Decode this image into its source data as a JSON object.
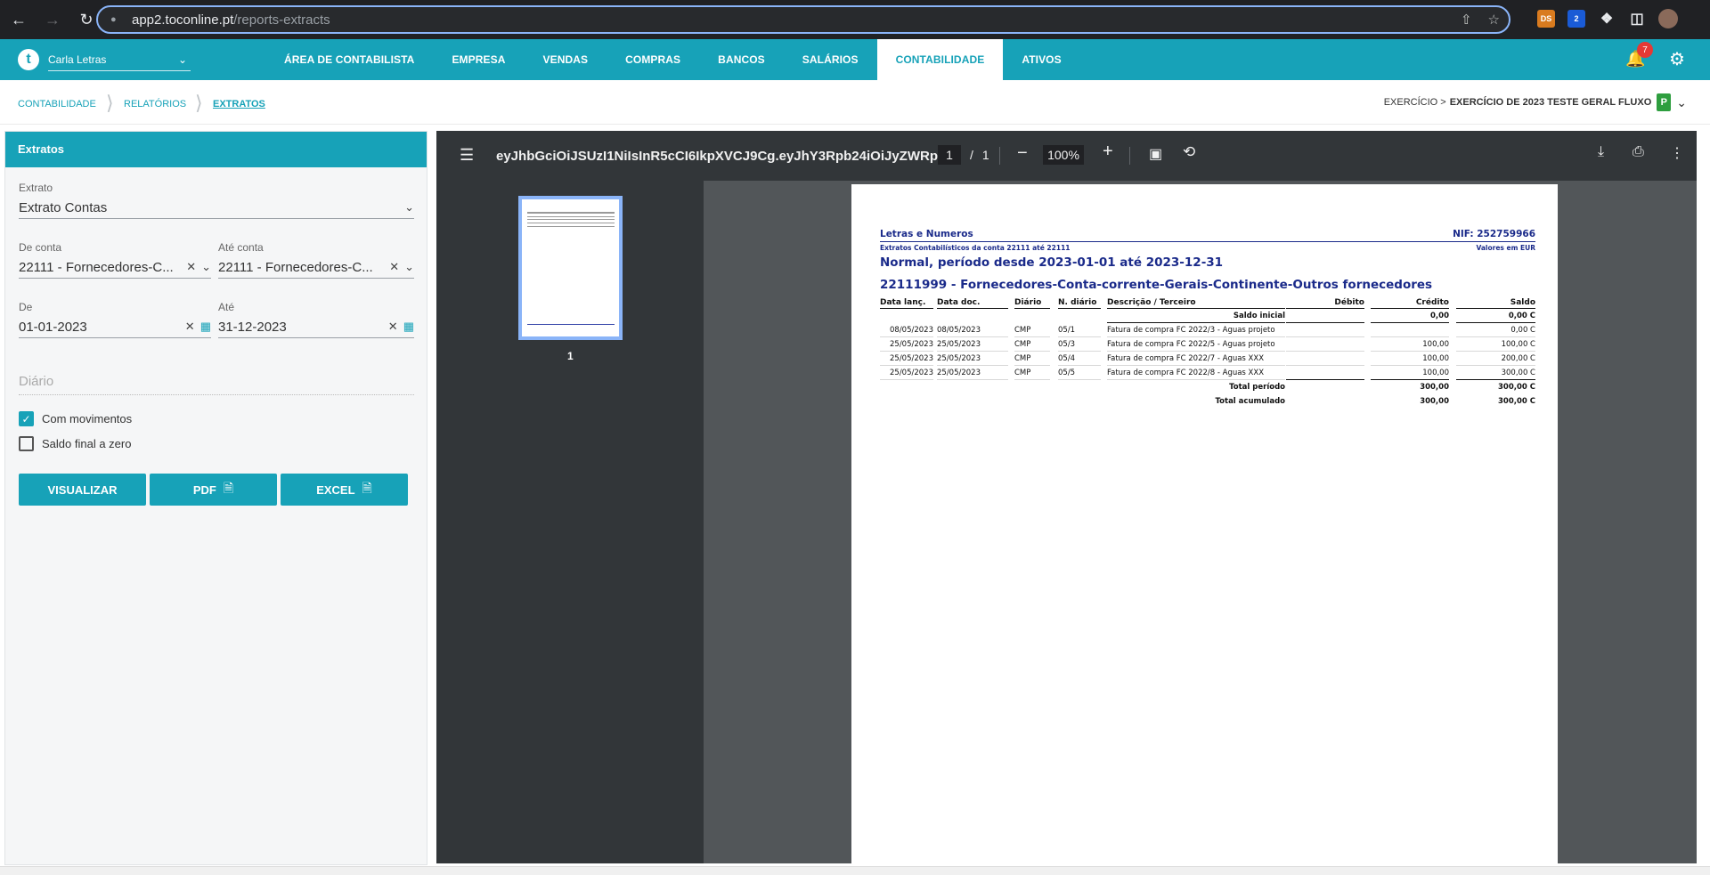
{
  "browser": {
    "url_host": "app2.toconline.pt",
    "url_path": "/reports-extracts",
    "ext_ds": "DS",
    "ext_badge": "2"
  },
  "topnav": {
    "logo": "t",
    "user": "Carla Letras",
    "menu": [
      "ÁREA DE CONTABILISTA",
      "EMPRESA",
      "VENDAS",
      "COMPRAS",
      "BANCOS",
      "SALÁRIOS",
      "CONTABILIDADE",
      "ATIVOS"
    ],
    "active_menu": "CONTABILIDADE",
    "notifications": "7"
  },
  "breadcrumb": {
    "items": [
      "CONTABILIDADE",
      "RELATÓRIOS",
      "EXTRATOS"
    ],
    "exercise_prefix": "EXERCÍCIO >",
    "exercise_name": "EXERCÍCIO DE 2023 TESTE GERAL FLUXO",
    "exercise_badge": "P"
  },
  "form": {
    "title": "Extratos",
    "extrato_label": "Extrato",
    "extrato_value": "Extrato Contas",
    "de_conta_label": "De conta",
    "de_conta_value": "22111 - Fornecedores-C...",
    "ate_conta_label": "Até conta",
    "ate_conta_value": "22111 - Fornecedores-C...",
    "de_label": "De",
    "de_value": "01-01-2023",
    "ate_label": "Até",
    "ate_value": "31-12-2023",
    "diario_placeholder": "Diário",
    "com_movimentos": "Com movimentos",
    "com_movimentos_checked": true,
    "saldo_final": "Saldo final a zero",
    "saldo_final_checked": false,
    "btn_visualizar": "VISUALIZAR",
    "btn_pdf": "PDF",
    "btn_excel": "EXCEL"
  },
  "viewer": {
    "title": "eyJhbGciOiJSUzI1NiIsInR5cCI6IkpXVCJ9Cg.eyJhY3Rpb24iOiJyZWRp...",
    "page_current": "1",
    "page_sep": "/",
    "page_total": "1",
    "zoom": "100%",
    "thumb_label": "1"
  },
  "pdf": {
    "company": "Letras e Numeros",
    "nif": "NIF: 252759966",
    "subtitle": "Extratos Contabilísticos da conta 22111 até 22111",
    "currency": "Valores em EUR",
    "period": "Normal, período desde 2023-01-01 até 2023-12-31",
    "account": "22111999 - Fornecedores-Conta-corrente-Gerais-Continente-Outros fornecedores",
    "headers": [
      "Data lanç.",
      "Data doc.",
      "Diário",
      "N. diário",
      "Descrição / Terceiro",
      "Débito",
      "Crédito",
      "Saldo"
    ],
    "saldo_inicial_label": "Saldo inicial",
    "saldo_inicial_credito": "0,00",
    "saldo_inicial_saldo": "0,00 C",
    "rows": [
      {
        "data_lanc": "08/05/2023",
        "data_doc": "08/05/2023",
        "diario": "CMP",
        "n_diario": "05/1",
        "descricao": "Fatura de compra FC 2022/3 - Aguas projeto",
        "debito": "",
        "credito": "",
        "saldo": "0,00 C"
      },
      {
        "data_lanc": "25/05/2023",
        "data_doc": "25/05/2023",
        "diario": "CMP",
        "n_diario": "05/3",
        "descricao": "Fatura de compra FC 2022/5 - Aguas projeto",
        "debito": "",
        "credito": "100,00",
        "saldo": "100,00 C"
      },
      {
        "data_lanc": "25/05/2023",
        "data_doc": "25/05/2023",
        "diario": "CMP",
        "n_diario": "05/4",
        "descricao": "Fatura de compra FC 2022/7 - Aguas XXX",
        "debito": "",
        "credito": "100,00",
        "saldo": "200,00 C"
      },
      {
        "data_lanc": "25/05/2023",
        "data_doc": "25/05/2023",
        "diario": "CMP",
        "n_diario": "05/5",
        "descricao": "Fatura de compra FC 2022/8 - Aguas XXX",
        "debito": "",
        "credito": "100,00",
        "saldo": "300,00 C"
      }
    ],
    "total_periodo_label": "Total período",
    "total_periodo_credito": "300,00",
    "total_periodo_saldo": "300,00 C",
    "total_acumulado_label": "Total acumulado",
    "total_acumulado_credito": "300,00",
    "total_acumulado_saldo": "300,00 C"
  }
}
